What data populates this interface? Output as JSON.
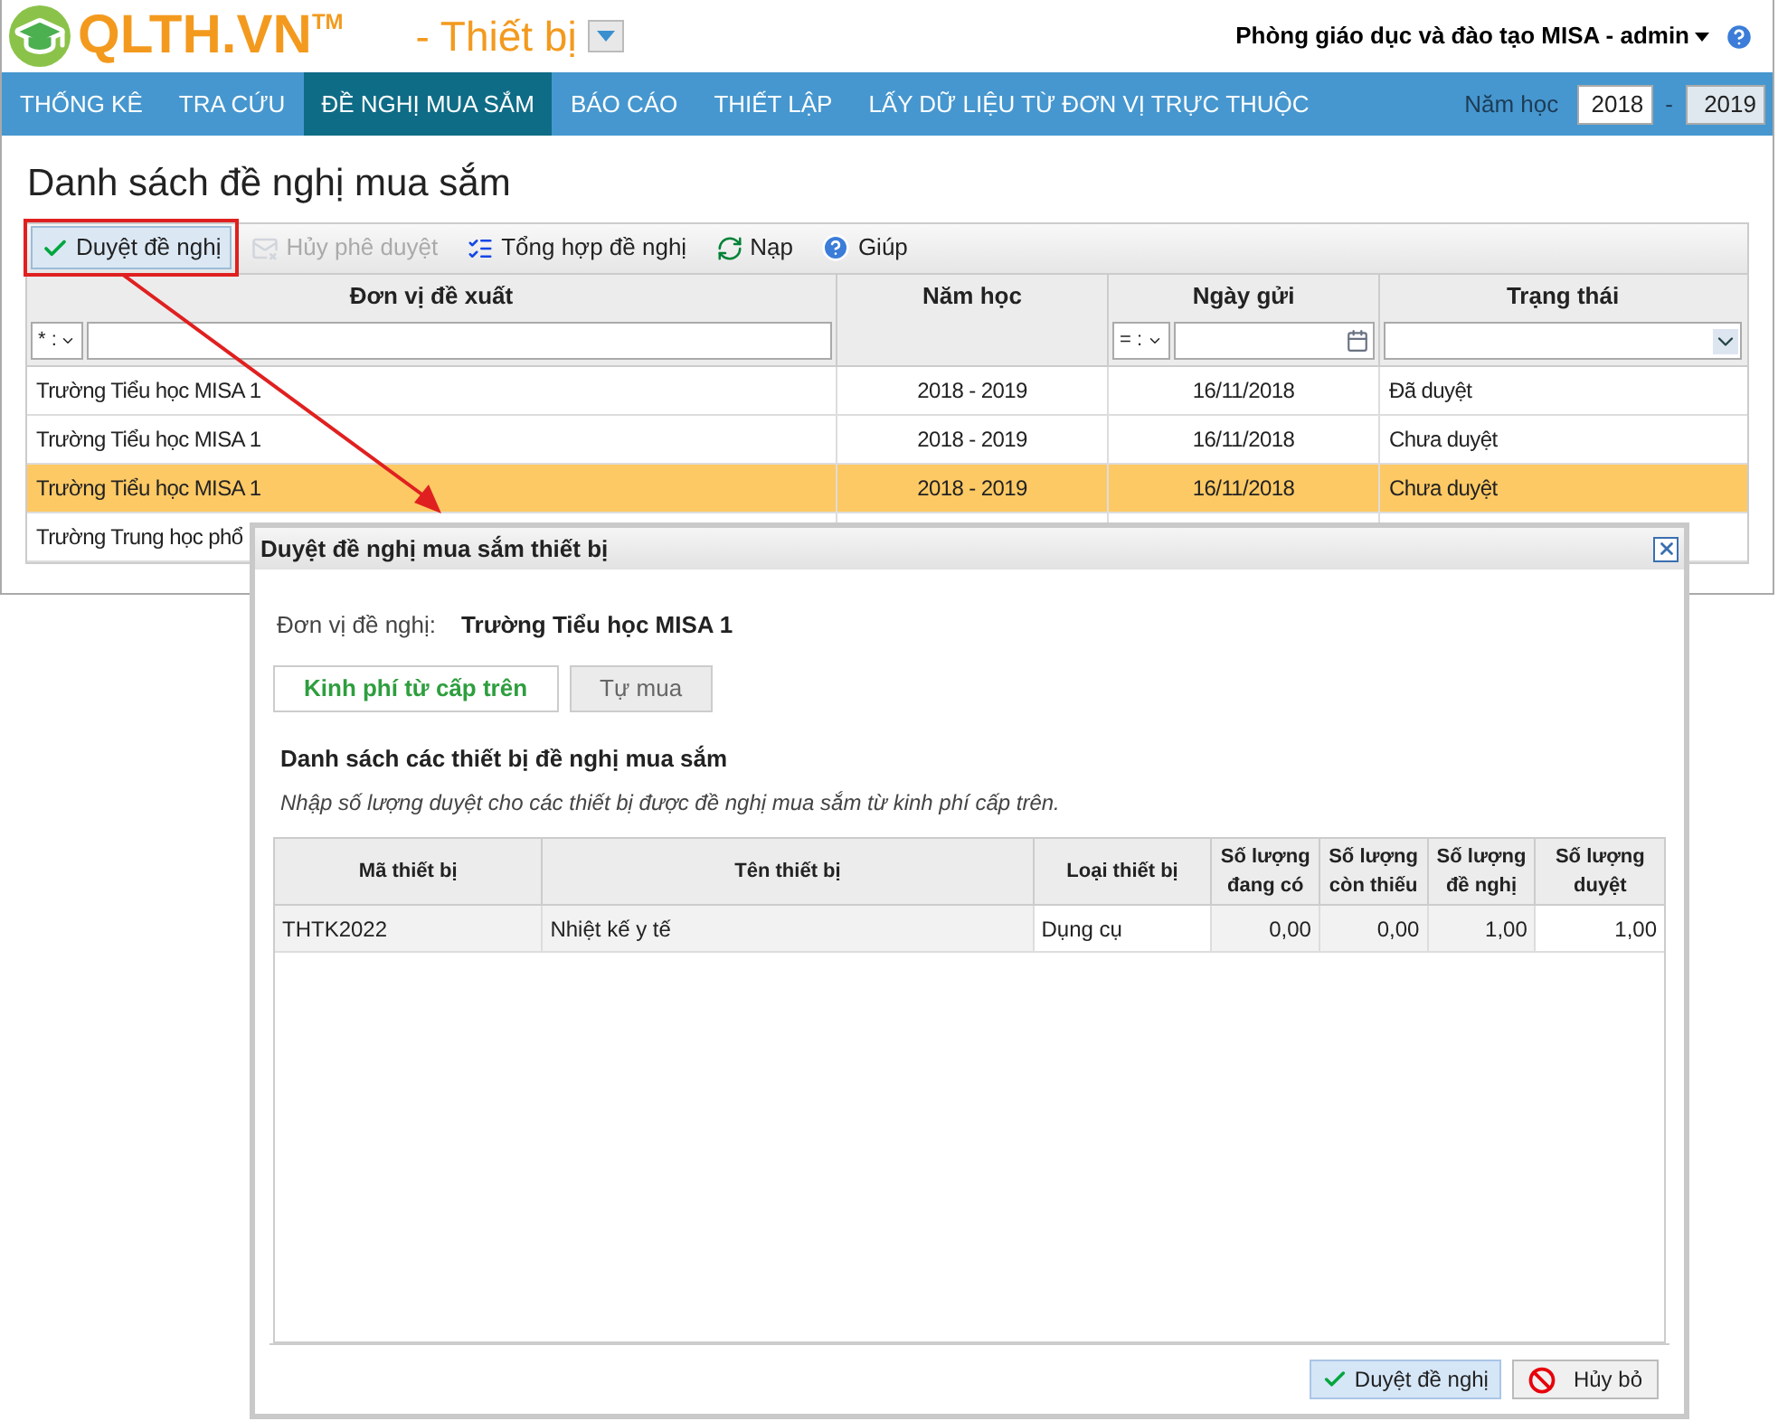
{
  "header": {
    "logo": "QLTH.VN",
    "logo_mark": "TM",
    "module": "- Thiết bị",
    "user": "Phòng giáo dục và đào tạo MISA - admin"
  },
  "nav": {
    "items": [
      {
        "label": "THỐNG KÊ",
        "selected": false
      },
      {
        "label": "TRA CỨU",
        "selected": false
      },
      {
        "label": "ĐỀ NGHỊ MUA SẮM",
        "selected": true
      },
      {
        "label": "BÁO CÁO",
        "selected": false
      },
      {
        "label": "THIẾT LẬP",
        "selected": false
      },
      {
        "label": "LẤY DỮ LIỆU TỪ ĐƠN VỊ TRỰC THUỘC",
        "selected": false
      }
    ],
    "year_label": "Năm học",
    "year_from": "2018",
    "year_sep": "-",
    "year_to": "2019"
  },
  "page_title": "Danh sách đề nghị mua sắm",
  "toolbar": [
    {
      "kind": "approve",
      "label": "Duyệt đề nghị",
      "disabled": false,
      "highlighted": true
    },
    {
      "kind": "cancel",
      "label": "Hủy phê duyệt",
      "disabled": true,
      "highlighted": false
    },
    {
      "kind": "summary",
      "label": "Tổng hợp đề nghị",
      "disabled": false,
      "highlighted": false
    },
    {
      "kind": "reload",
      "label": "Nạp",
      "disabled": false,
      "highlighted": false
    },
    {
      "kind": "help",
      "label": "Giúp",
      "disabled": false,
      "highlighted": false
    }
  ],
  "table": {
    "columns": [
      "Đơn vị đề xuất",
      "Năm học",
      "Ngày gửi",
      "Trạng thái"
    ],
    "filters": {
      "unit_op": "* :",
      "date_op": "= :"
    },
    "rows": [
      {
        "cells": [
          "Trường Tiểu học MISA 1",
          "2018 - 2019",
          "16/11/2018",
          "Đã duyệt"
        ],
        "selected": false
      },
      {
        "cells": [
          "Trường Tiểu học MISA 1",
          "2018 - 2019",
          "16/11/2018",
          "Chưa duyệt"
        ],
        "selected": false
      },
      {
        "cells": [
          "Trường Tiểu học MISA 1",
          "2018 - 2019",
          "16/11/2018",
          "Chưa duyệt"
        ],
        "selected": true
      },
      {
        "cells": [
          "Trường Trung học phổ"
        ],
        "selected": false
      }
    ]
  },
  "dialog": {
    "title": "Duyệt đề nghị mua sắm thiết bị",
    "unit_label": "Đơn vị đề nghị:",
    "unit_value": "Trường Tiểu học MISA 1",
    "tabs": [
      {
        "label": "Kinh phí từ cấp trên",
        "selected": true
      },
      {
        "label": "Tự mua",
        "selected": false
      }
    ],
    "section_title": "Danh sách các thiết bị đề nghị mua sắm",
    "hint": "Nhập số lượng duyệt cho các thiết bị được đề nghị mua sắm từ kinh phí cấp trên.",
    "columns": [
      "Mã thiết bị",
      "Tên thiết bị",
      "Loại thiết bị",
      "Số lượng đang có",
      "Số lượng còn thiếu",
      "Số lượng đề nghị",
      "Số lượng duyệt"
    ],
    "rows": [
      {
        "cells": [
          "THTK2022",
          "Nhiệt kế y tế",
          "Dụng cụ",
          "0,00",
          "0,00",
          "1,00",
          "1,00"
        ]
      }
    ],
    "buttons": [
      {
        "kind": "approve",
        "label": "Duyệt đề nghị"
      },
      {
        "kind": "cancel",
        "label": "Hủy bỏ"
      }
    ]
  }
}
